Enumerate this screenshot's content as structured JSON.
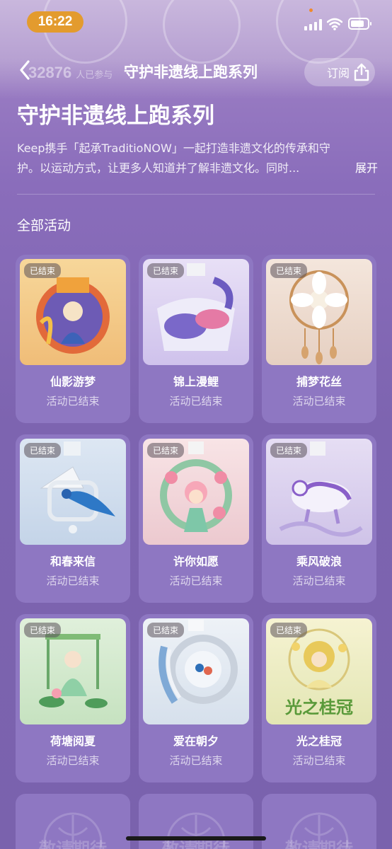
{
  "status_bar": {
    "time": "16:22"
  },
  "nav": {
    "participants_count": "32876",
    "participants_label": "人已参与",
    "title": "守护非遗线上跑系列",
    "subscribe_label": "订阅"
  },
  "header": {
    "title": "守护非遗线上跑系列",
    "description_line1": "Keep携手「起承TraditioNOW」一起打造非遗文化的传承和守",
    "description_line2": "护。以运动方式，让更多人知道并了解非遗文化。同时...",
    "expand_label": "展开"
  },
  "section": {
    "title": "全部活动"
  },
  "cards": [
    {
      "badge": "已结束",
      "title": "仙影游梦",
      "status": "活动已结束",
      "bg": "#f2c98a"
    },
    {
      "badge": "已结束",
      "title": "锦上漫鲤",
      "status": "活动已结束",
      "bg": "#d9cdf0"
    },
    {
      "badge": "已结束",
      "title": "捕梦花丝",
      "status": "活动已结束",
      "bg": "#ecdcd0"
    },
    {
      "badge": "已结束",
      "title": "和春来信",
      "status": "活动已结束",
      "bg": "#cfdcec"
    },
    {
      "badge": "已结束",
      "title": "许你如愿",
      "status": "活动已结束",
      "bg": "#f3dce0"
    },
    {
      "badge": "已结束",
      "title": "乘风破浪",
      "status": "活动已结束",
      "bg": "#ddd5ef"
    },
    {
      "badge": "已结束",
      "title": "荷塘阅夏",
      "status": "活动已结束",
      "bg": "#d6ead0"
    },
    {
      "badge": "已结束",
      "title": "爱在朝夕",
      "status": "活动已结束",
      "bg": "#dfe6f0"
    },
    {
      "badge": "已结束",
      "title": "光之桂冠",
      "status": "活动已结束",
      "bg": "#eef0c8",
      "image_text": "光之桂冠"
    }
  ],
  "ghost_cards": [
    {
      "text": "敬请期待"
    },
    {
      "text": "敬请期待"
    },
    {
      "text": "敬请期待"
    }
  ],
  "colors": {
    "accent": "#e39b2e",
    "card": "#8e77c2",
    "background": "#7b62ad"
  }
}
